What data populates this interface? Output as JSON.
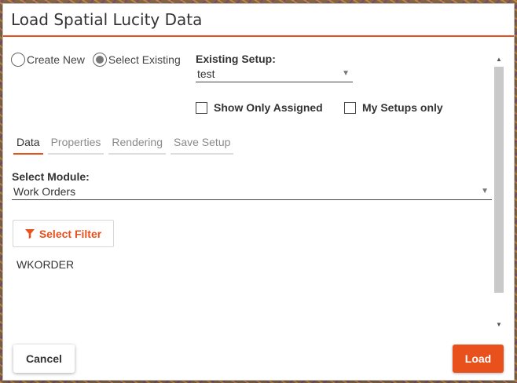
{
  "dialog": {
    "title": "Load Spatial Lucity Data"
  },
  "mode": {
    "options": [
      {
        "label": "Create New",
        "selected": false
      },
      {
        "label": "Select Existing",
        "selected": true
      }
    ]
  },
  "setup": {
    "label": "Existing Setup:",
    "value": "test"
  },
  "filters": {
    "show_only_assigned": {
      "label": "Show Only Assigned",
      "checked": false
    },
    "my_setups_only": {
      "label": "My Setups only",
      "checked": false
    }
  },
  "tabs": [
    {
      "label": "Data",
      "active": true
    },
    {
      "label": "Properties",
      "active": false
    },
    {
      "label": "Rendering",
      "active": false
    },
    {
      "label": "Save Setup",
      "active": false
    }
  ],
  "module": {
    "label": "Select Module:",
    "value": "Work Orders"
  },
  "filter_button": {
    "label": "Select Filter",
    "icon": "funnel-icon"
  },
  "filter_value": "WKORDER",
  "footer": {
    "cancel_label": "Cancel",
    "load_label": "Load"
  },
  "colors": {
    "accent": "#e8501c",
    "text": "#333333",
    "tab_inactive": "#8a8a8a"
  }
}
